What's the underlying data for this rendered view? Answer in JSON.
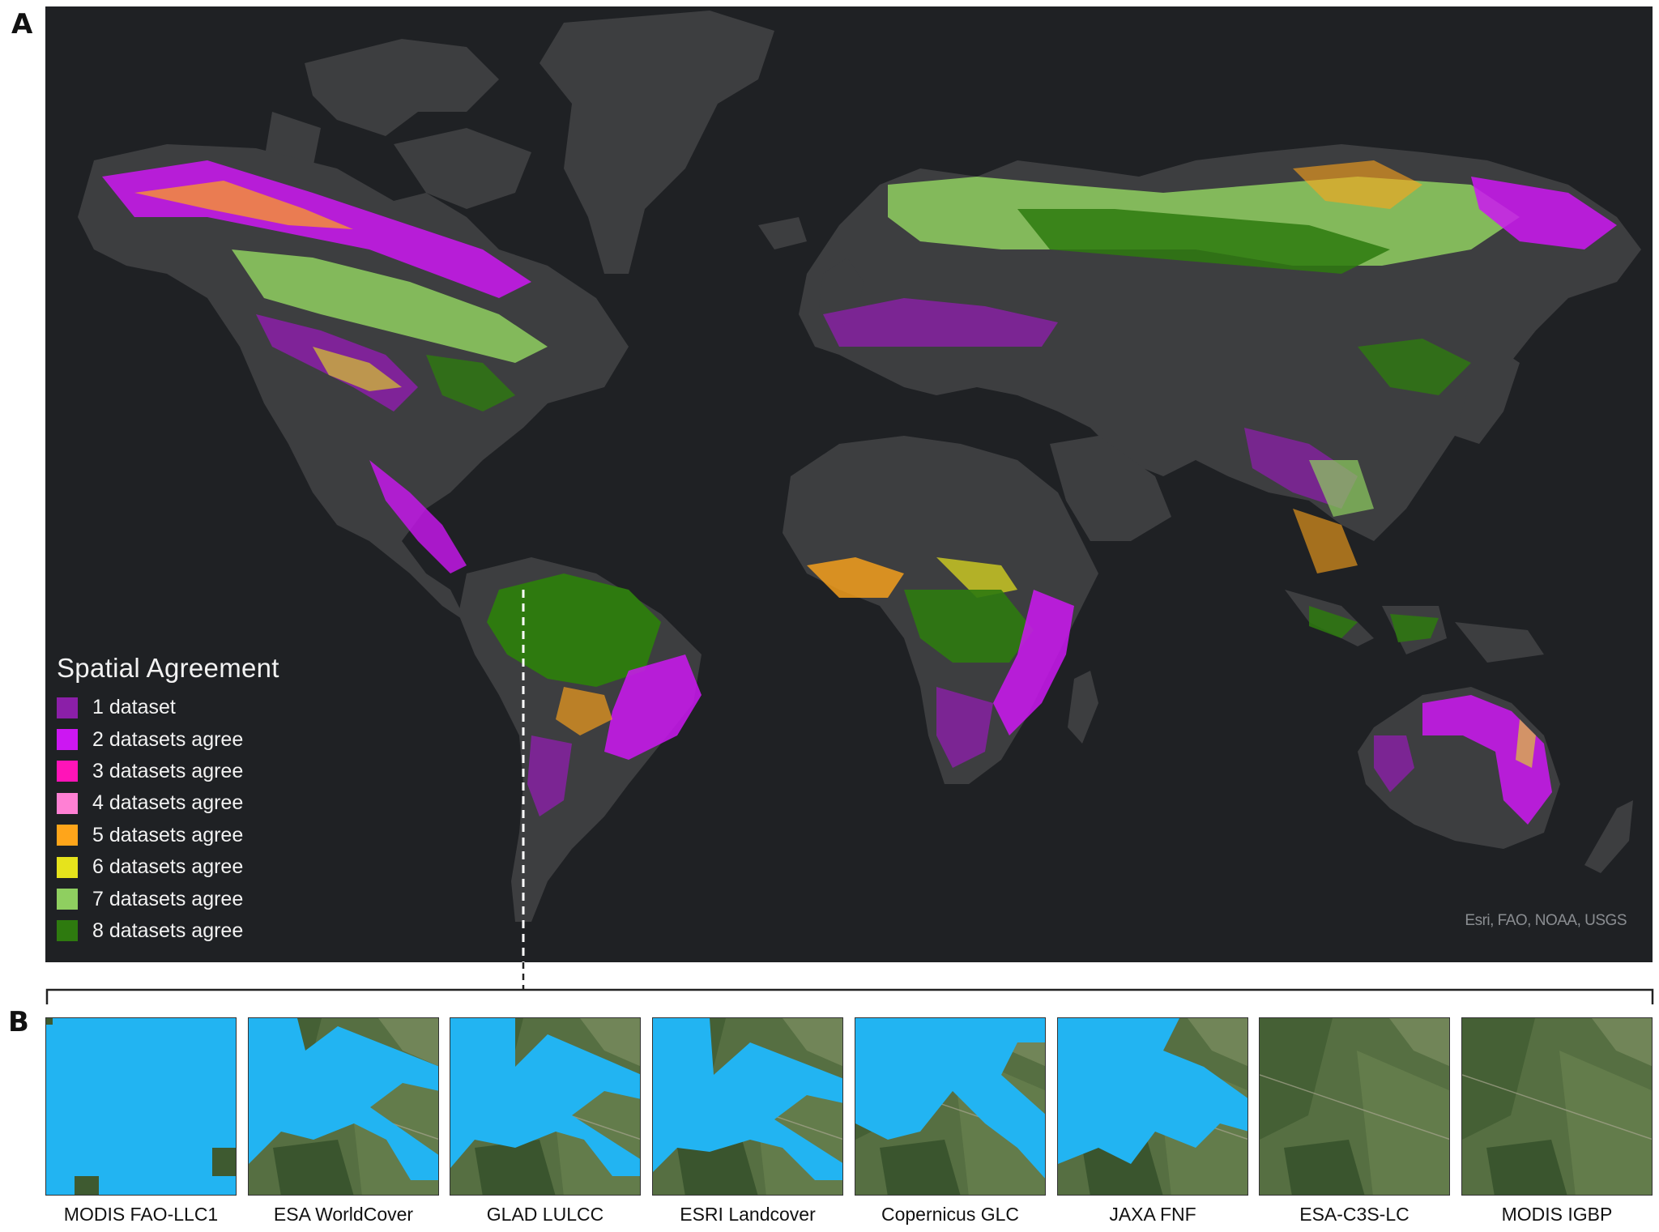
{
  "panel_a": {
    "letter": "A"
  },
  "panel_b": {
    "letter": "B"
  },
  "legend": {
    "title": "Spatial Agreement",
    "items": [
      {
        "label": "1 dataset",
        "color": "#8b1fa8"
      },
      {
        "label": "2 datasets agree",
        "color": "#cc17f2"
      },
      {
        "label": "3 datasets agree",
        "color": "#ff14b8"
      },
      {
        "label": "4 datasets agree",
        "color": "#ff80d4"
      },
      {
        "label": "5 datasets agree",
        "color": "#ffa51a"
      },
      {
        "label": "6 datasets agree",
        "color": "#e6e31c"
      },
      {
        "label": "7 datasets agree",
        "color": "#8fcf60"
      },
      {
        "label": "8 datasets agree",
        "color": "#2e7a0f"
      }
    ]
  },
  "attribution": "Esri, FAO, NOAA, USGS",
  "map_colors": {
    "ocean": "#1f2124",
    "land": "#3d3e40",
    "water_class": "#22b4f2"
  },
  "thumbnails": [
    {
      "label": "MODIS FAO-LLC1"
    },
    {
      "label": "ESA WorldCover"
    },
    {
      "label": "GLAD LULCC"
    },
    {
      "label": "ESRI Landcover"
    },
    {
      "label": "Copernicus GLC"
    },
    {
      "label": "JAXA FNF"
    },
    {
      "label": "ESA-C3S-LC"
    },
    {
      "label": "MODIS IGBP"
    }
  ]
}
